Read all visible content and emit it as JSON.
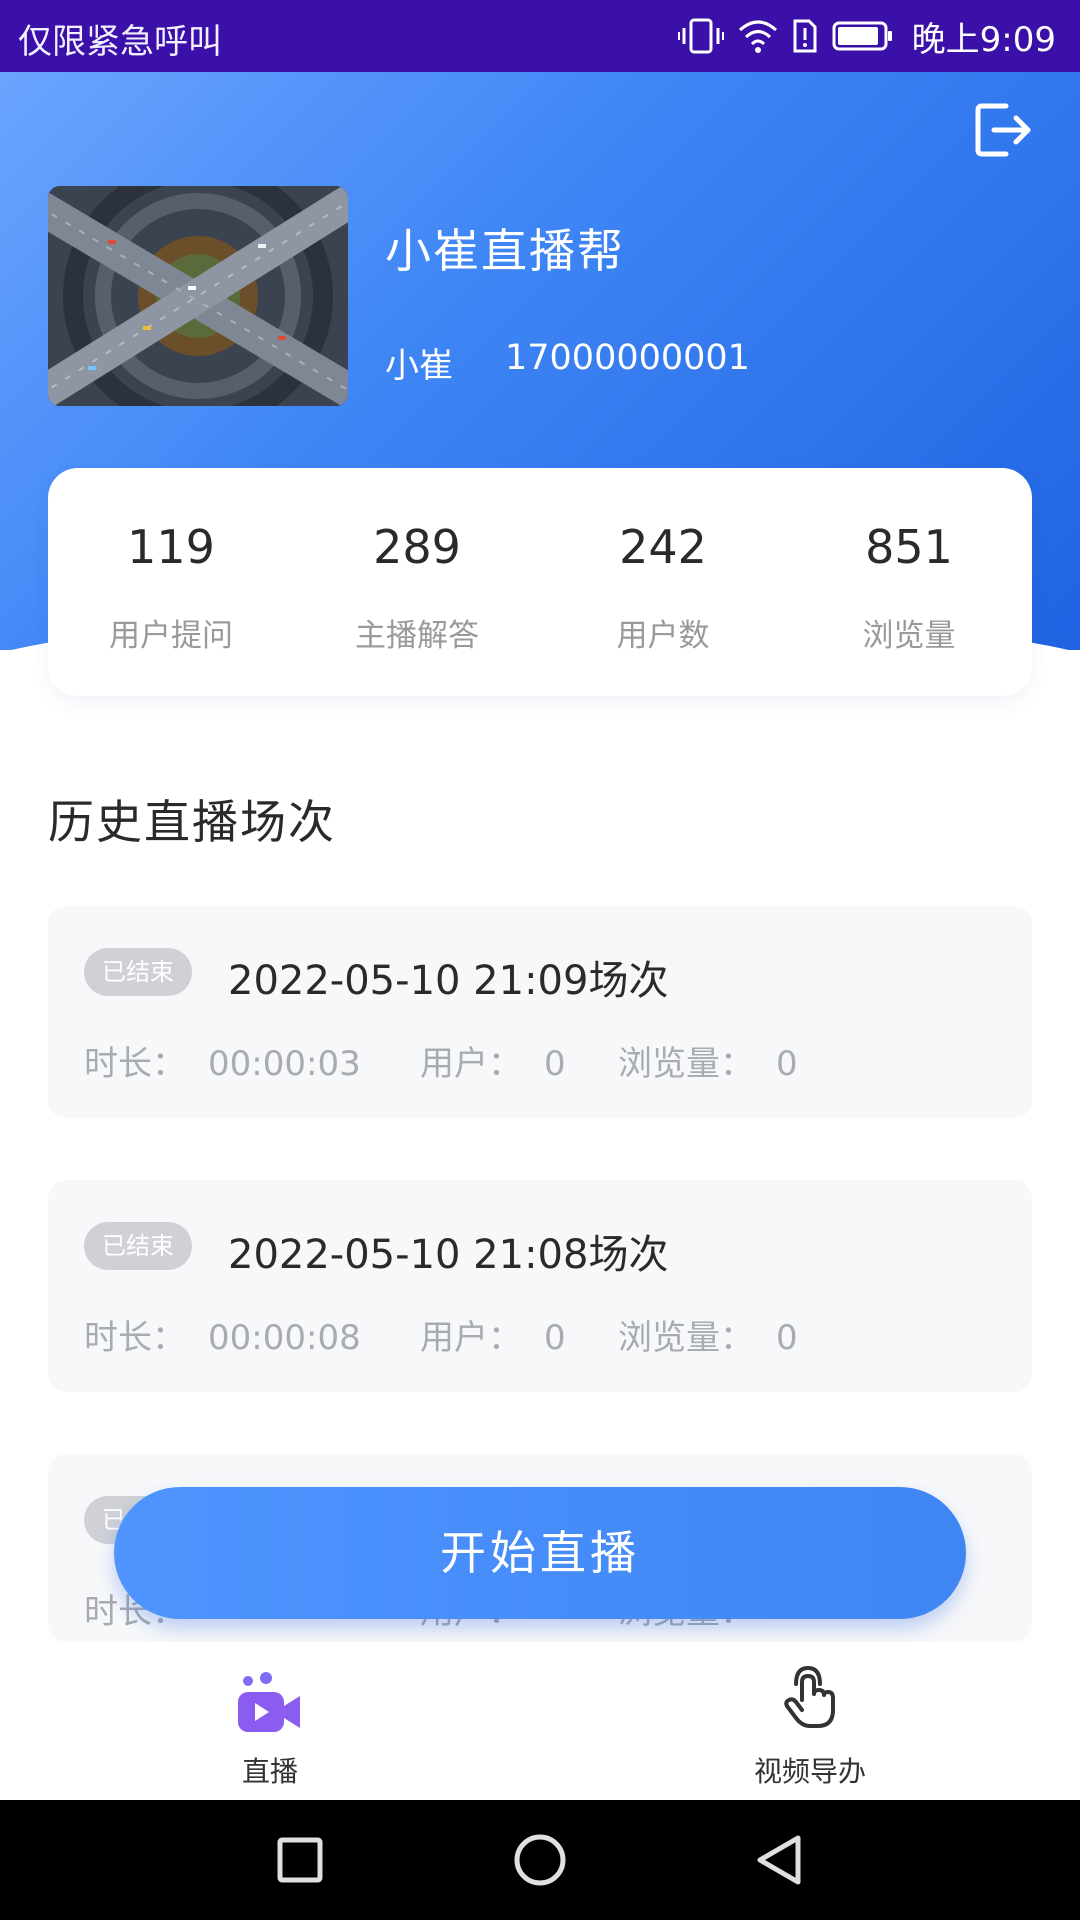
{
  "status_bar": {
    "carrier_text": "仅限紧急呼叫",
    "time": "晚上9:09",
    "icons": [
      "vibrate-icon",
      "wifi-icon",
      "sim-alert-icon",
      "battery-icon"
    ]
  },
  "header": {
    "app_name": "小崔直播帮",
    "user_name": "小崔",
    "phone": "17000000001",
    "logout_icon": "logout-icon",
    "gradient_colors": [
      "#6aa4ff",
      "#1f63e2"
    ]
  },
  "stats": [
    {
      "value": "119",
      "label": "用户提问"
    },
    {
      "value": "289",
      "label": "主播解答"
    },
    {
      "value": "242",
      "label": "用户数"
    },
    {
      "value": "851",
      "label": "浏览量"
    }
  ],
  "section_title": "历史直播场次",
  "sessions": [
    {
      "badge": "已结束",
      "title": "2022-05-10 21:09场次",
      "duration_label": "时长：",
      "duration": "00:00:03",
      "users_label": "用户：",
      "users": "0",
      "views_label": "浏览量：",
      "views": "0"
    },
    {
      "badge": "已结束",
      "title": "2022-05-10 21:08场次",
      "duration_label": "时长：",
      "duration": "00:00:08",
      "users_label": "用户：",
      "users": "0",
      "views_label": "浏览量：",
      "views": "0"
    },
    {
      "badge": "已结束",
      "title": "",
      "duration_label": "时长：",
      "duration": "",
      "users_label": "用户：",
      "users": "",
      "views_label": "浏览量：",
      "views": ""
    }
  ],
  "start_button": "开始直播",
  "bottom_nav": [
    {
      "label": "直播",
      "icon": "live-video-icon",
      "active": true
    },
    {
      "label": "视频导办",
      "icon": "tap-hand-icon",
      "active": false
    }
  ],
  "system_nav": [
    "recent-apps-icon",
    "home-icon",
    "back-icon"
  ],
  "accent_color": "#4f94ff"
}
